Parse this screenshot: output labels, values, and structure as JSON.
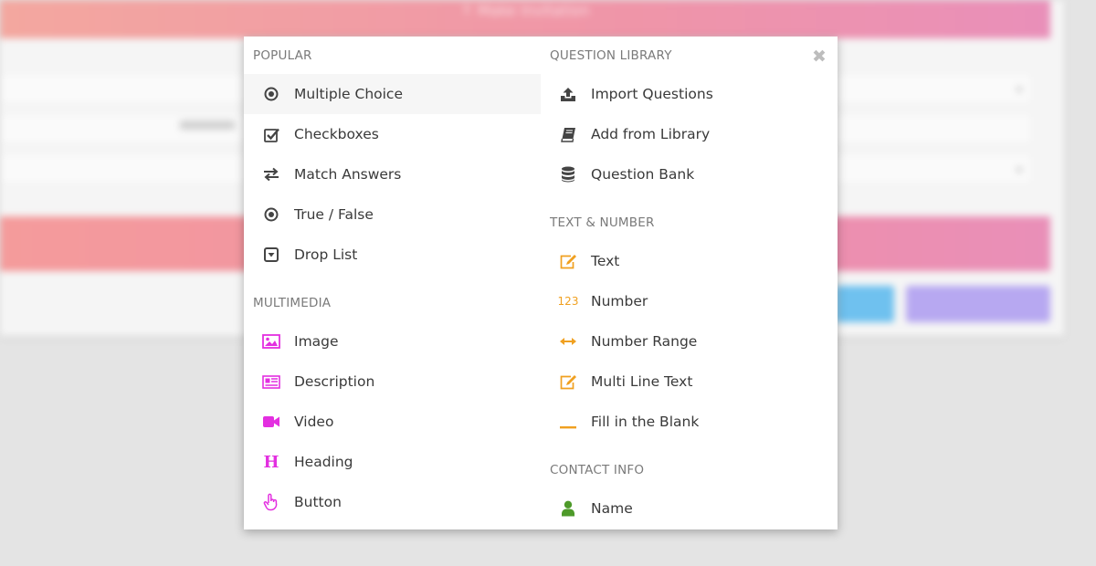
{
  "background": {
    "banner_text": "↑ Make Invitation"
  },
  "popup": {
    "close_glyph": "✖",
    "sections": {
      "popular": {
        "title": "POPULAR",
        "items": [
          {
            "label": "Multiple Choice",
            "icon": "radio-icon"
          },
          {
            "label": "Checkboxes",
            "icon": "checkbox-icon"
          },
          {
            "label": "Match Answers",
            "icon": "swap-arrows-icon"
          },
          {
            "label": "True / False",
            "icon": "radio-icon"
          },
          {
            "label": "Drop List",
            "icon": "dropdown-box-icon"
          }
        ]
      },
      "multimedia": {
        "title": "MULTIMEDIA",
        "items": [
          {
            "label": "Image",
            "icon": "image-icon"
          },
          {
            "label": "Description",
            "icon": "newspaper-icon"
          },
          {
            "label": "Video",
            "icon": "video-camera-icon"
          },
          {
            "label": "Heading",
            "icon": "heading-icon",
            "glyph": "H"
          },
          {
            "label": "Button",
            "icon": "pointer-hand-icon"
          }
        ]
      },
      "question_library": {
        "title": "QUESTION LIBRARY",
        "items": [
          {
            "label": "Import Questions",
            "icon": "upload-icon"
          },
          {
            "label": "Add from Library",
            "icon": "book-icon"
          },
          {
            "label": "Question Bank",
            "icon": "database-icon"
          }
        ]
      },
      "text_number": {
        "title": "TEXT & NUMBER",
        "items": [
          {
            "label": "Text",
            "icon": "edit-icon"
          },
          {
            "label": "Number",
            "icon": "numbers-icon",
            "glyph": "123"
          },
          {
            "label": "Number Range",
            "icon": "horizontal-arrows-icon"
          },
          {
            "label": "Multi Line Text",
            "icon": "edit-icon"
          },
          {
            "label": "Fill in the Blank",
            "icon": "underline-blank-icon"
          }
        ]
      },
      "contact_info": {
        "title": "CONTACT INFO",
        "items": [
          {
            "label": "Name",
            "icon": "user-icon"
          }
        ]
      }
    }
  },
  "colors": {
    "popular_icon": "#444444",
    "multimedia_icon": "#e32fe0",
    "library_icon": "#444444",
    "text_number_icon": "#f0a020",
    "contact_icon": "#4e9a2a",
    "section_title": "#7a7a7a",
    "item_text": "#3a3a3a",
    "active_row": "#f6f6f6"
  }
}
